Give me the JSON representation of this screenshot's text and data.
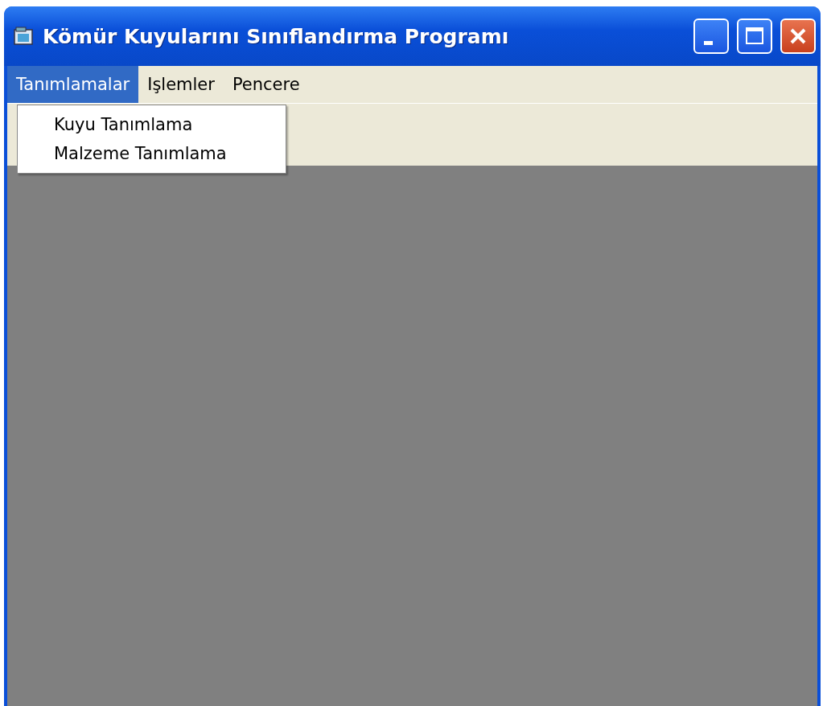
{
  "window": {
    "title": "Kömür Kuyularını Sınıflandırma Programı"
  },
  "menu": [
    {
      "label": "Tanımlamalar",
      "selected": true
    },
    {
      "label": "Işlemler",
      "selected": false
    },
    {
      "label": "Pencere",
      "selected": false
    }
  ],
  "dropdown": {
    "items": [
      {
        "label": "Kuyu Tanımlama"
      },
      {
        "label": "Malzeme Tanımlama"
      }
    ]
  }
}
